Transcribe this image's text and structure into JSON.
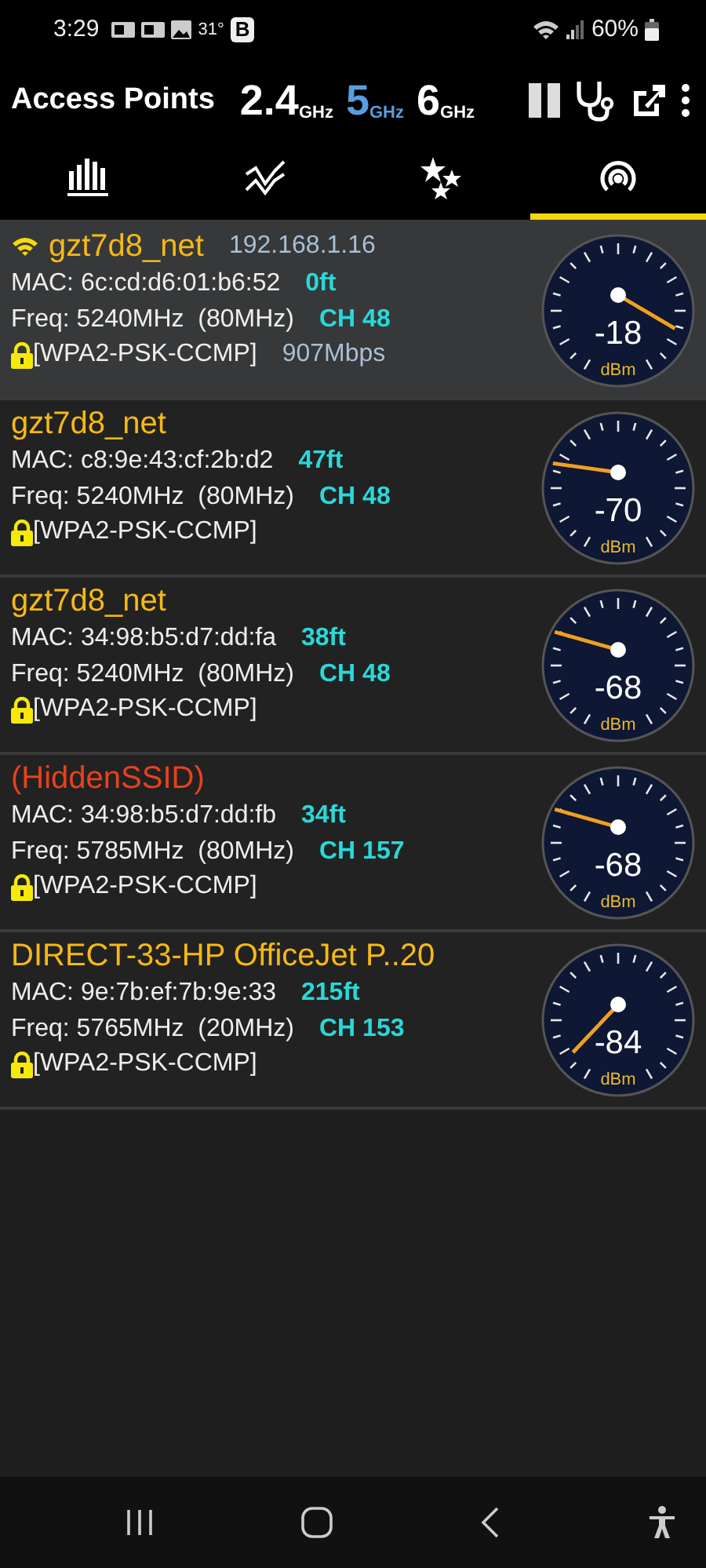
{
  "status_bar": {
    "time": "3:29",
    "temperature": "31°",
    "badge": "B",
    "battery": "60%"
  },
  "header": {
    "title": "Access Points",
    "bands": [
      {
        "label": "2.4",
        "unit": "GHz",
        "selected": false
      },
      {
        "label": "5",
        "unit": "GHz",
        "selected": true
      },
      {
        "label": "6",
        "unit": "GHz",
        "selected": false
      }
    ]
  },
  "tabs": [
    {
      "kind": "bars",
      "selected": false
    },
    {
      "kind": "trend",
      "selected": false
    },
    {
      "kind": "stars",
      "selected": false
    },
    {
      "kind": "signal",
      "selected": true
    }
  ],
  "networks": [
    {
      "ssid": "gzt7d8_net",
      "color": "#f5b915",
      "selected": true,
      "ip": "192.168.1.16",
      "mac": "MAC: 6c:cd:d6:01:b6:52",
      "distance": "0ft",
      "freq": "Freq: 5240MHz  (80MHz)",
      "channel": "CH 48",
      "security": "[WPA2-PSK-CCMP]",
      "speed": "907Mbps",
      "reading": "-18",
      "unit": "dBm"
    },
    {
      "ssid": "gzt7d8_net",
      "color": "#f5b915",
      "selected": false,
      "mac": "MAC: c8:9e:43:cf:2b:d2",
      "distance": "47ft",
      "freq": "Freq: 5240MHz  (80MHz)",
      "channel": "CH 48",
      "security": "[WPA2-PSK-CCMP]",
      "reading": "-70",
      "unit": "dBm"
    },
    {
      "ssid": "gzt7d8_net",
      "color": "#f5b915",
      "selected": false,
      "mac": "MAC: 34:98:b5:d7:dd:fa",
      "distance": "38ft",
      "freq": "Freq: 5240MHz  (80MHz)",
      "channel": "CH 48",
      "security": "[WPA2-PSK-CCMP]",
      "reading": "-68",
      "unit": "dBm"
    },
    {
      "ssid": "(HiddenSSID)",
      "color": "#e8411c",
      "selected": false,
      "mac": "MAC: 34:98:b5:d7:dd:fb",
      "distance": "34ft",
      "freq": "Freq: 5785MHz  (80MHz)",
      "channel": "CH 157",
      "security": "[WPA2-PSK-CCMP]",
      "reading": "-68",
      "unit": "dBm"
    },
    {
      "ssid": "DIRECT-33-HP OfficeJet P..20",
      "color": "#f5b915",
      "selected": false,
      "mac": "MAC: 9e:7b:ef:7b:9e:33",
      "distance": "215ft",
      "freq": "Freq: 5765MHz  (20MHz)",
      "channel": "CH 153",
      "security": "[WPA2-PSK-CCMP]",
      "reading": "-84",
      "unit": "dBm"
    }
  ]
}
